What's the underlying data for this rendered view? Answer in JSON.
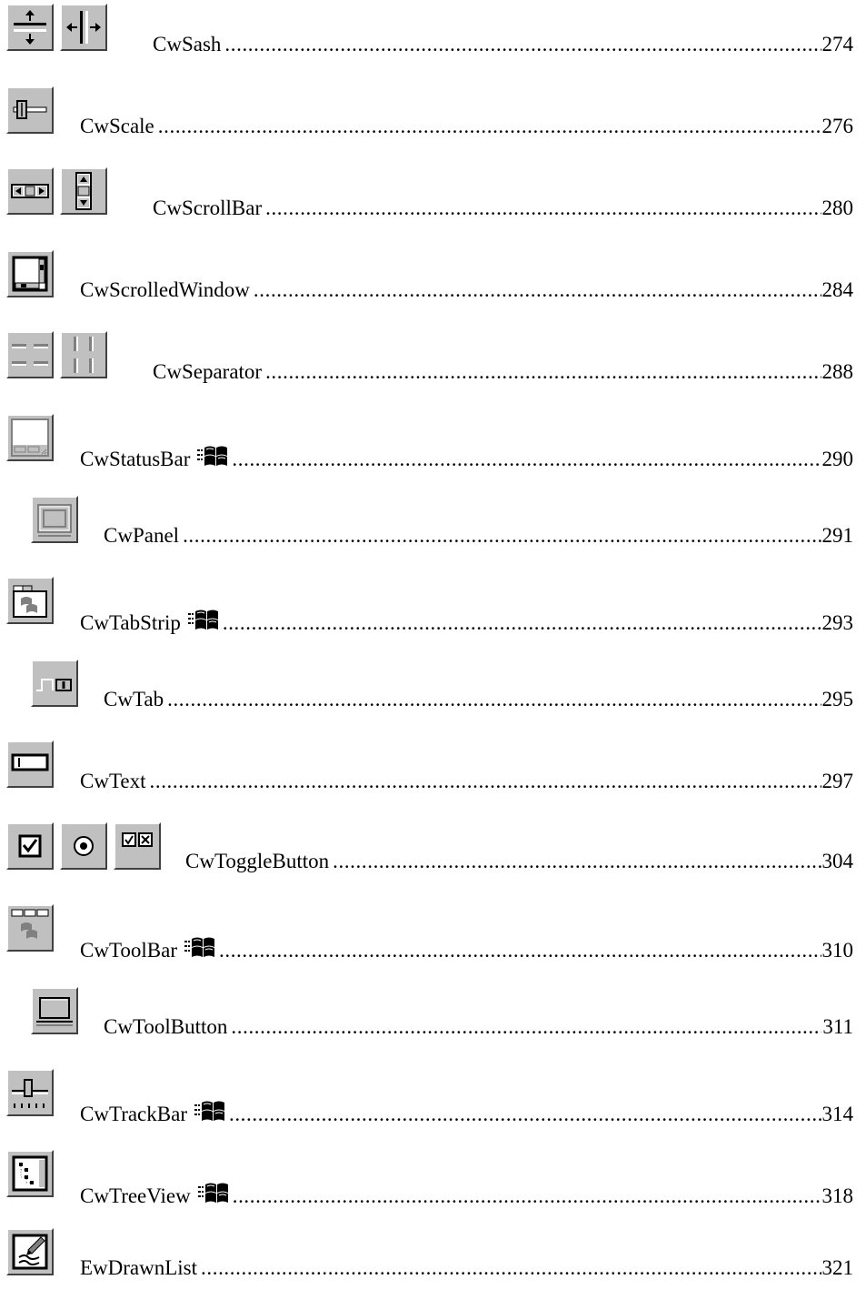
{
  "entries": [
    {
      "name": "CwSash",
      "page": "274"
    },
    {
      "name": "CwScale",
      "page": "276"
    },
    {
      "name": "CwScrollBar",
      "page": "280"
    },
    {
      "name": "CwScrolledWindow",
      "page": "284"
    },
    {
      "name": "CwSeparator",
      "page": "288"
    },
    {
      "name": "CwStatusBar",
      "page": "290"
    },
    {
      "name": "CwPanel",
      "page": "291"
    },
    {
      "name": "CwTabStrip",
      "page": "293"
    },
    {
      "name": "CwTab",
      "page": "295"
    },
    {
      "name": "CwText",
      "page": "297"
    },
    {
      "name": "CwToggleButton",
      "page": "304"
    },
    {
      "name": "CwToolBar",
      "page": "310"
    },
    {
      "name": "CwToolButton",
      "page": "311"
    },
    {
      "name": "CwTrackBar",
      "page": "314"
    },
    {
      "name": "CwTreeView",
      "page": "318"
    },
    {
      "name": "EwDrawnList",
      "page": "321"
    }
  ],
  "icons": {
    "CwSash": [
      "sash-horizontal-icon",
      "sash-vertical-icon"
    ],
    "CwScale": [
      "scale-icon"
    ],
    "CwScrollBar": [
      "scrollbar-horizontal-icon",
      "scrollbar-vertical-icon"
    ],
    "CwScrolledWindow": [
      "scrolled-window-icon"
    ],
    "CwSeparator": [
      "separator-horizontal-icon",
      "separator-vertical-icon"
    ],
    "CwStatusBar": [
      "statusbar-icon"
    ],
    "CwPanel": [
      "panel-icon"
    ],
    "CwTabStrip": [
      "tabstrip-icon"
    ],
    "CwTab": [
      "tab-icon"
    ],
    "CwText": [
      "text-icon"
    ],
    "CwToggleButton": [
      "checkbox-icon",
      "radio-icon",
      "toggle-pair-icon"
    ],
    "CwToolBar": [
      "toolbar-icon"
    ],
    "CwToolButton": [
      "toolbutton-icon"
    ],
    "CwTrackBar": [
      "trackbar-icon"
    ],
    "CwTreeView": [
      "treeview-icon"
    ],
    "EwDrawnList": [
      "drawn-list-icon"
    ]
  },
  "windows_only_flag": "windows-flag-icon"
}
